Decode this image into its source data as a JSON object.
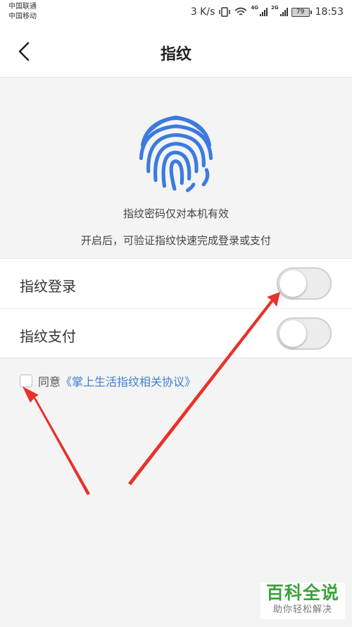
{
  "status_bar": {
    "carrier_1": "中国联通",
    "carrier_2": "中国移动",
    "speed": "3 K/s",
    "signal_1_gen": "4G",
    "signal_2_gen": "2G",
    "battery": "79",
    "time": "18:53",
    "icons": [
      "vibrate-icon",
      "wifi-icon",
      "signal-icon",
      "battery-icon"
    ]
  },
  "nav": {
    "title": "指纹",
    "back_icon": "chevron-left-icon"
  },
  "hero": {
    "icon": "fingerprint-icon",
    "icon_color": "#3b7be0",
    "line1": "指纹密码仅对本机有效",
    "line2": "开启后，可验证指纹快速完成登录或支付"
  },
  "settings": [
    {
      "label": "指纹登录",
      "enabled": false
    },
    {
      "label": "指纹支付",
      "enabled": false
    }
  ],
  "agreement": {
    "checked": false,
    "prefix": "同意",
    "link": "《掌上生活指纹相关协议》",
    "link_color": "#3f7fd0"
  },
  "annotation": {
    "arrow_color": "#e8312a"
  },
  "watermark": {
    "title": "百科全说",
    "subtitle": "助你轻松解决",
    "color": "#3aa33a"
  }
}
